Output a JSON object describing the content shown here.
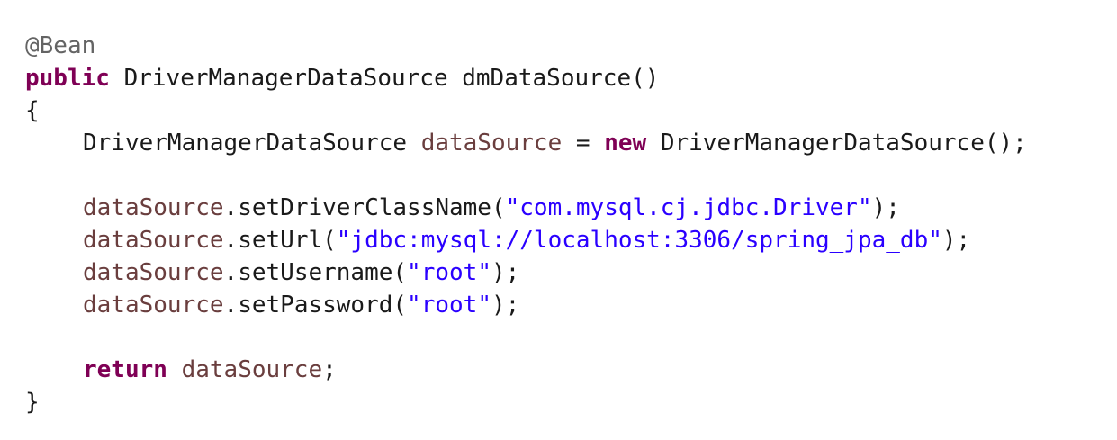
{
  "code": {
    "annotation": "@Bean",
    "kw_public": "public",
    "return_type": " DriverManagerDataSource dmDataSource()",
    "open_brace": "{",
    "decl_type": "DriverManagerDataSource ",
    "decl_var": "dataSource",
    "decl_assign": " = ",
    "kw_new": "new",
    "decl_ctor": " DriverManagerDataSource();",
    "var": "dataSource",
    "call1_method": ".setDriverClassName(",
    "call1_arg": "\"com.mysql.cj.jdbc.Driver\"",
    "call_end": ");",
    "call2_method": ".setUrl(",
    "call2_arg": "\"jdbc:mysql://localhost:3306/spring_jpa_db\"",
    "call3_method": ".setUsername(",
    "call3_arg": "\"root\"",
    "call4_method": ".setPassword(",
    "call4_arg": "\"root\"",
    "kw_return": "return",
    "return_var": " dataSource",
    "semicolon": ";",
    "close_brace": "}"
  },
  "colors": {
    "keyword": "#7f0055",
    "annotation": "#646464",
    "field": "#6a3e3e",
    "string": "#2a00ff",
    "text": "#1a1a1a",
    "background": "#ffffff"
  }
}
